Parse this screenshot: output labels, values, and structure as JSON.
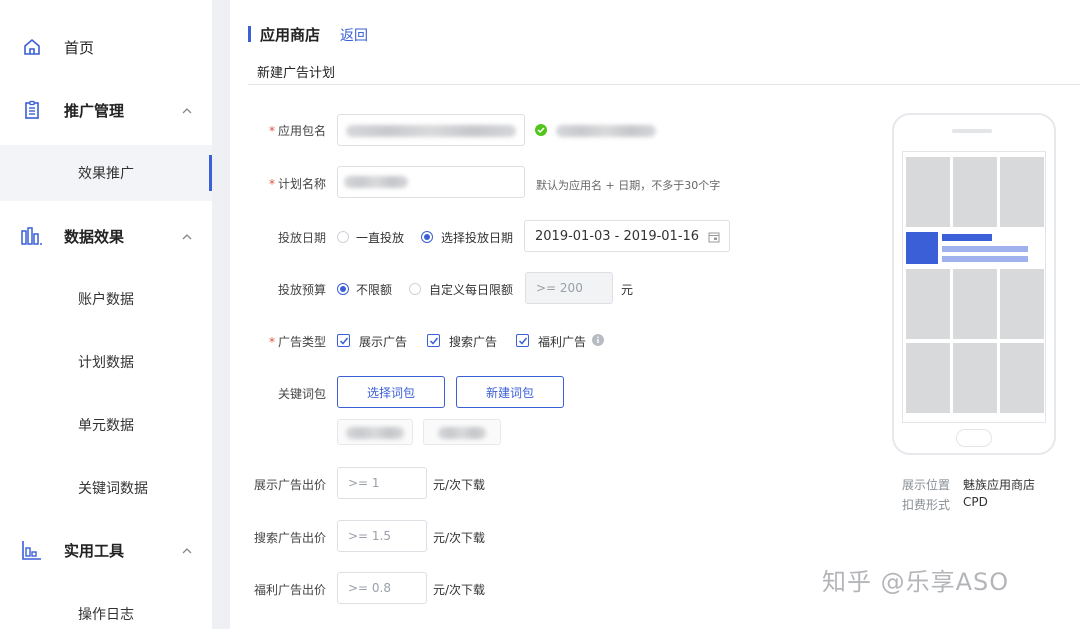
{
  "sidebar": {
    "home": "首页",
    "promotion_mgmt": "推广管理",
    "effect_promotion": "效果推广",
    "data_effect": "数据效果",
    "account_data": "账户数据",
    "plan_data": "计划数据",
    "unit_data": "单元数据",
    "keyword_data": "关键词数据",
    "tools": "实用工具",
    "operation_log": "操作日志"
  },
  "header": {
    "title": "应用商店",
    "back_label": "返回",
    "subtitle": "新建广告计划"
  },
  "form": {
    "app_package_label": "应用包名",
    "plan_name_label": "计划名称",
    "plan_name_hint": "默认为应用名 + 日期，不多于30个字",
    "date_label": "投放日期",
    "date_opt_always": "一直投放",
    "date_opt_select": "选择投放日期",
    "date_range": "2019-01-03 - 2019-01-16",
    "budget_label": "投放预算",
    "budget_opt_unlimited": "不限额",
    "budget_opt_custom": "自定义每日限额",
    "budget_placeholder": ">= 200",
    "budget_unit": "元",
    "ad_type_label": "广告类型",
    "ad_type_display": "展示广告",
    "ad_type_search": "搜索广告",
    "ad_type_welfare": "福利广告",
    "keyword_label": "关键词包",
    "select_keyword_btn": "选择词包",
    "new_keyword_btn": "新建词包",
    "display_bid_label": "展示广告出价",
    "display_bid_placeholder": ">= 1",
    "search_bid_label": "搜索广告出价",
    "search_bid_placeholder": ">= 1.5",
    "welfare_bid_label": "福利广告出价",
    "welfare_bid_placeholder": ">= 0.8",
    "bid_unit": "元/次下载"
  },
  "preview": {
    "position_key": "展示位置",
    "position_value": "魅族应用商店",
    "billing_key": "扣费形式",
    "billing_value": "CPD"
  },
  "watermark": "知乎 @乐享ASO",
  "colors": {
    "accent": "#3a5fd6",
    "required": "#e0533b",
    "ok": "#52c41a"
  }
}
